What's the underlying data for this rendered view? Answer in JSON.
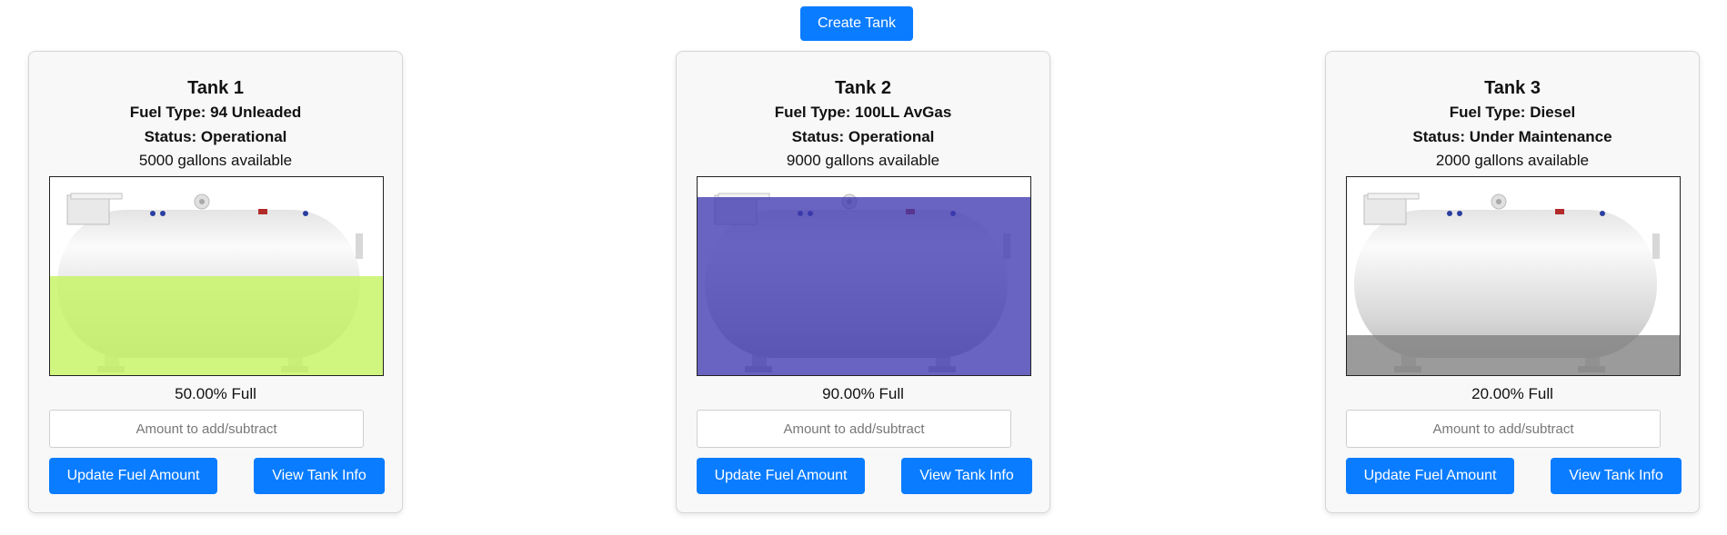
{
  "toolbar": {
    "create_label": "Create Tank"
  },
  "tanks": [
    {
      "title": "Tank 1",
      "fuel_type": "Fuel Type: 94 Unleaded",
      "status": "Status: Operational",
      "gallons": "5000 gallons available",
      "percent_text": "50.00% Full",
      "fill_fraction": 0.5,
      "fill_color": "#c8f56a",
      "fill_opacity": 0.85,
      "input_placeholder": "Amount to add/subtract",
      "update_label": "Update Fuel Amount",
      "info_label": "View Tank Info"
    },
    {
      "title": "Tank 2",
      "fuel_type": "Fuel Type: 100LL AvGas",
      "status": "Status: Operational",
      "gallons": "9000 gallons available",
      "percent_text": "90.00% Full",
      "fill_fraction": 0.9,
      "fill_color": "#3f39b0",
      "fill_opacity": 0.78,
      "input_placeholder": "Amount to add/subtract",
      "update_label": "Update Fuel Amount",
      "info_label": "View Tank Info"
    },
    {
      "title": "Tank 3",
      "fuel_type": "Fuel Type: Diesel",
      "status": "Status: Under Maintenance",
      "gallons": "2000 gallons available",
      "percent_text": "20.00% Full",
      "fill_fraction": 0.2,
      "fill_color": "#7f7f7f",
      "fill_opacity": 0.78,
      "input_placeholder": "Amount to add/subtract",
      "update_label": "Update Fuel Amount",
      "info_label": "View Tank Info"
    }
  ]
}
